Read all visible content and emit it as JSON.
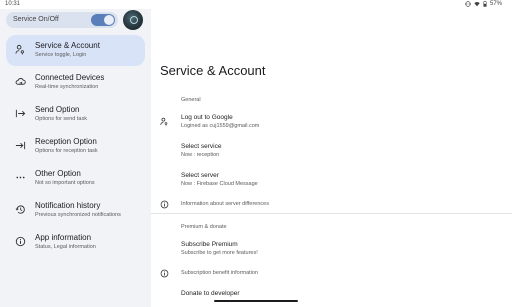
{
  "status_bar": {
    "time": "10:31",
    "battery": "57%"
  },
  "sidebar": {
    "service_toggle_label": "Service On/Off",
    "service_toggle_on": true,
    "items": [
      {
        "title": "Service & Account",
        "subtitle": "Service toggle, Login",
        "icon": "account-key-icon",
        "selected": true
      },
      {
        "title": "Connected Devices",
        "subtitle": "Real-time synchronization",
        "icon": "cloud-sync-icon",
        "selected": false
      },
      {
        "title": "Send Option",
        "subtitle": "Options for send task",
        "icon": "arrow-right-bar-icon",
        "selected": false
      },
      {
        "title": "Reception Option",
        "subtitle": "Options for reception task",
        "icon": "arrow-into-bar-icon",
        "selected": false
      },
      {
        "title": "Other Option",
        "subtitle": "Not so important options",
        "icon": "more-horizontal-icon",
        "selected": false
      },
      {
        "title": "Notification history",
        "subtitle": "Previous synchronized notifications",
        "icon": "history-icon",
        "selected": false
      },
      {
        "title": "App information",
        "subtitle": "Status, Legal information",
        "icon": "info-icon",
        "selected": false
      }
    ]
  },
  "main": {
    "title": "Service & Account",
    "general": {
      "header": "General",
      "logout_title": "Log out to Google",
      "logout_sub": "Logined as cuj1559@gmail.com",
      "select_service_title": "Select service",
      "select_service_sub": "Now : reception",
      "select_server_title": "Select server",
      "select_server_sub": "Now : Firebase Cloud Message",
      "server_info": "Information about server differences"
    },
    "premium": {
      "header": "Premium & donate",
      "subscribe_title": "Subscribe Premium",
      "subscribe_sub": "Subscribe to get more features!",
      "subscription_info": "Subscription benefit information",
      "donate_title": "Donate to developer"
    }
  },
  "colors": {
    "sidebar_bg": "#f1f3f7",
    "selected_item_bg": "#d8e3f8",
    "switch_on": "#5b7fb8"
  }
}
